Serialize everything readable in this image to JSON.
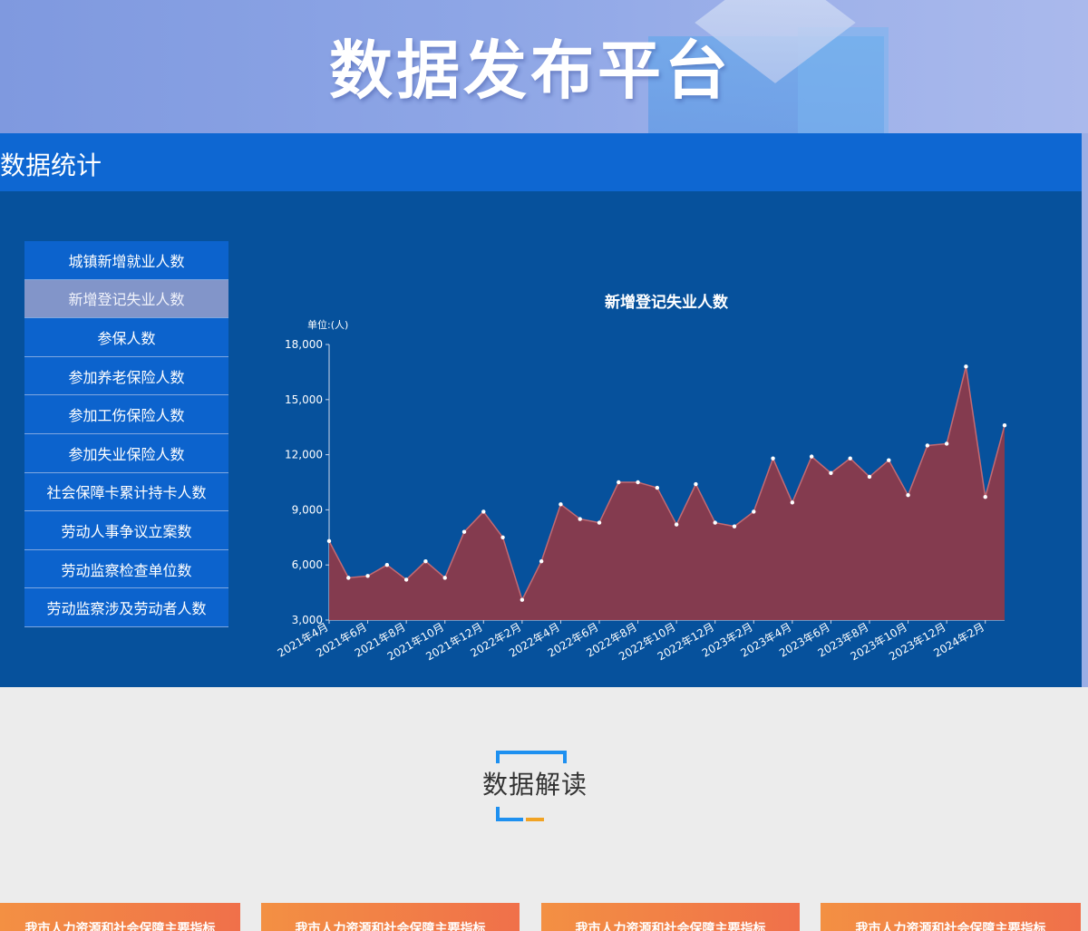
{
  "banner": {
    "title": "数据发布平台"
  },
  "stats": {
    "header": "数据统计",
    "menu": [
      "城镇新增就业人数",
      "新增登记失业人数",
      "参保人数",
      "参加养老保险人数",
      "参加工伤保险人数",
      "参加失业保险人数",
      "社会保障卡累计持卡人数",
      "劳动人事争议立案数",
      "劳动监察检查单位数",
      "劳动监察涉及劳动者人数"
    ],
    "active_index": 1
  },
  "chart_data": {
    "type": "area",
    "title": "新增登记失业人数",
    "ylabel": "单位:(人)",
    "xlabel": "",
    "ylim": [
      3000,
      18000
    ],
    "yticks": [
      "3,000",
      "6,000",
      "9,000",
      "12,000",
      "15,000",
      "18,000"
    ],
    "x": [
      "2021年4月",
      "2021年5月",
      "2021年6月",
      "2021年7月",
      "2021年8月",
      "2021年9月",
      "2021年10月",
      "2021年11月",
      "2021年12月",
      "2022年1月",
      "2022年2月",
      "2022年3月",
      "2022年4月",
      "2022年5月",
      "2022年6月",
      "2022年7月",
      "2022年8月",
      "2022年9月",
      "2022年10月",
      "2022年11月",
      "2022年12月",
      "2023年1月",
      "2023年2月",
      "2023年3月",
      "2023年4月",
      "2023年5月",
      "2023年6月",
      "2023年7月",
      "2023年8月",
      "2023年9月",
      "2023年10月",
      "2023年11月",
      "2023年12月",
      "2024年1月",
      "2024年2月",
      "2024年3月"
    ],
    "xtick_labels": [
      "2021年4月",
      "2021年6月",
      "2021年8月",
      "2021年10月",
      "2021年12月",
      "2022年2月",
      "2022年4月",
      "2022年6月",
      "2022年8月",
      "2022年10月",
      "2022年12月",
      "2023年2月",
      "2023年4月",
      "2023年6月",
      "2023年8月",
      "2023年10月",
      "2023年12月",
      "2024年2月"
    ],
    "values": [
      7300,
      5300,
      5400,
      6000,
      5200,
      6200,
      5300,
      7800,
      8900,
      7500,
      4100,
      6200,
      9300,
      8500,
      8300,
      10500,
      10500,
      10200,
      8200,
      10400,
      8300,
      8100,
      8900,
      11800,
      9400,
      11900,
      11000,
      11800,
      10800,
      11700,
      9800,
      12500,
      12600,
      16800,
      9700,
      13600
    ],
    "colors": {
      "fill": "#8b3a4b",
      "line": "#c46a72",
      "point": "#ffffff"
    },
    "grid": false
  },
  "interpretation": {
    "title": "数据解读",
    "cards": [
      "我市人力资源和社会保障主要指标",
      "我市人力资源和社会保障主要指标",
      "我市人力资源和社会保障主要指标",
      "我市人力资源和社会保障主要指标"
    ]
  }
}
